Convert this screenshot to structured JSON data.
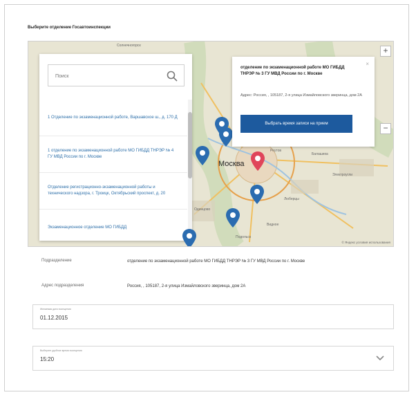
{
  "form": {
    "heading": "Выберите отделение Госавтоинспекции"
  },
  "map": {
    "search_placeholder": "Поиск",
    "list_items": [
      "1 Отделение по экзаменационной работе, Варшавское ш., д. 170 Д",
      "1 отделение по экзаменационной работе МО ГИБДД ТНРЭР № 4 ГУ МВД России по г. Москве",
      "Отделение регистрационно-экзаменационной работы и технического надзора, г. Троицк, Октябрьский проспект, д. 20",
      "Экзаменационное отделение МО ГИБДД"
    ],
    "popup": {
      "title": "отделение по экзаменационной работе МО ГИБДД ТНРЭР № 3 ГУ МВД России по г. Москве",
      "address": "Адрес: Россия, , 105187, 2-я улица Измайловского зверинца, дом 2А",
      "button": "Выбрать время записи на прием",
      "close": "×"
    },
    "zoom_in": "+",
    "zoom_out": "−",
    "city_label": "Москва",
    "credit": "© Яндекс условия использования",
    "labels": {
      "top": "Солнечногорск",
      "left_bottom": "Одинцово",
      "right1": "Реутов",
      "right2": "Балашиха",
      "right3": "Электроугли",
      "mid": "Люберцы",
      "bottom": "Видное",
      "bottom2": "Подольск"
    }
  },
  "details": {
    "division_label": "Подразделение",
    "division_value": "отделение по экзаменационной работе МО ГИБДД ТНРЭР № 3 ГУ МВД России по г. Москве",
    "address_label": "Адрес подразделения",
    "address_value": "Россия, , 105187, 2-я улица Измайловского зверинца, дом 2А"
  },
  "date_field": {
    "label": "Желаемая дата посещения",
    "value": "01.12.2015"
  },
  "time_field": {
    "label": "Выберите удобное время посещения",
    "value": "15:20"
  },
  "colors": {
    "accent": "#1d5a9e",
    "pin_blue": "#2b6cb0",
    "pin_red": "#e0455a"
  }
}
